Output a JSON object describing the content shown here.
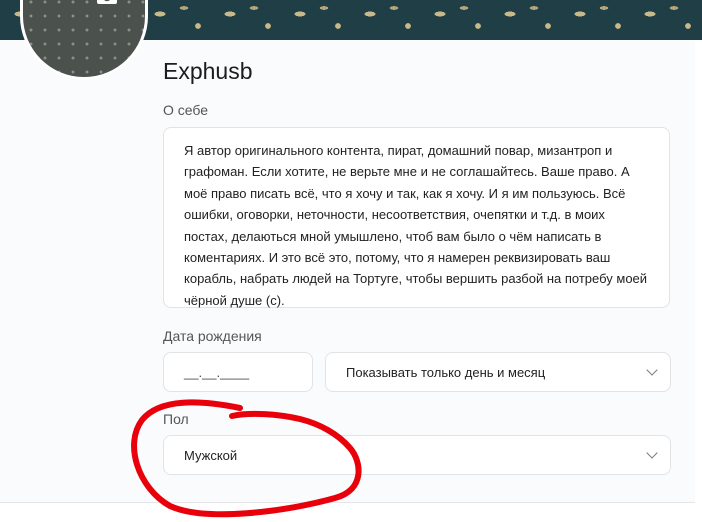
{
  "profile": {
    "name": "Exphusb",
    "avatar_icon": "camera-icon"
  },
  "about": {
    "label": "О себе",
    "text": "Я автор оригинального контента, пират, домашний повар, мизантроп и графоман. Если хотите, не верьте мне и не соглашайтесь. Ваше право. А моё право писать всё, что я хочу и так, как я хочу. И я им пользуюсь. Всё ошибки, оговорки, неточности, несоответствия, очепятки и т.д. в моих постах, делаються мной умышлено, чтоб вам было о чём написать в коментариях. И это всё это, потому, что я намерен реквизировать ваш корабль, набрать людей на Тортуге, чтобы вершить разбой на потребу моей чёрной душе (с)."
  },
  "birthdate": {
    "label": "Дата рождения",
    "placeholder": "__.__.____",
    "visibility": "Показывать только день и месяц"
  },
  "gender": {
    "label": "Пол",
    "value": "Мужской"
  },
  "colors": {
    "banner": "#1f3e45",
    "annotation": "#e8000b"
  }
}
